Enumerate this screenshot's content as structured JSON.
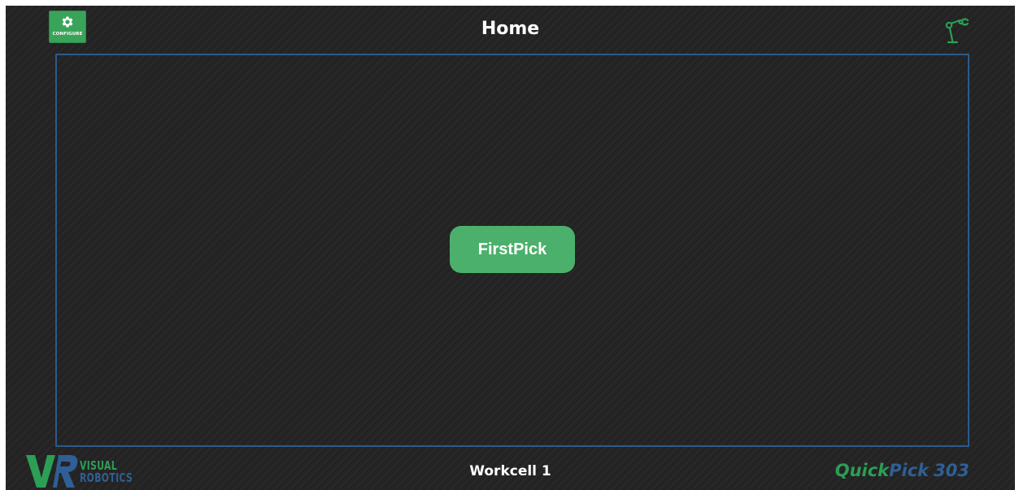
{
  "header": {
    "title": "Home",
    "configure_label": "CONFIGURE"
  },
  "icons": {
    "configure": "gear-icon",
    "robot_status": "robot-arm-icon"
  },
  "main": {
    "program_button_label": "FirstPick"
  },
  "footer": {
    "logo_line1": "VISUAL",
    "logo_line2": "ROBOTICS",
    "workcell": "Workcell 1",
    "product_quick": "Quick",
    "product_pick": "Pick",
    "product_number": "303"
  },
  "colors": {
    "background": "#232323",
    "accent_green": "#4bb06b",
    "panel_border": "#2a5b8c",
    "brand_blue": "#2f5f95",
    "brand_green": "#2c9e56"
  }
}
